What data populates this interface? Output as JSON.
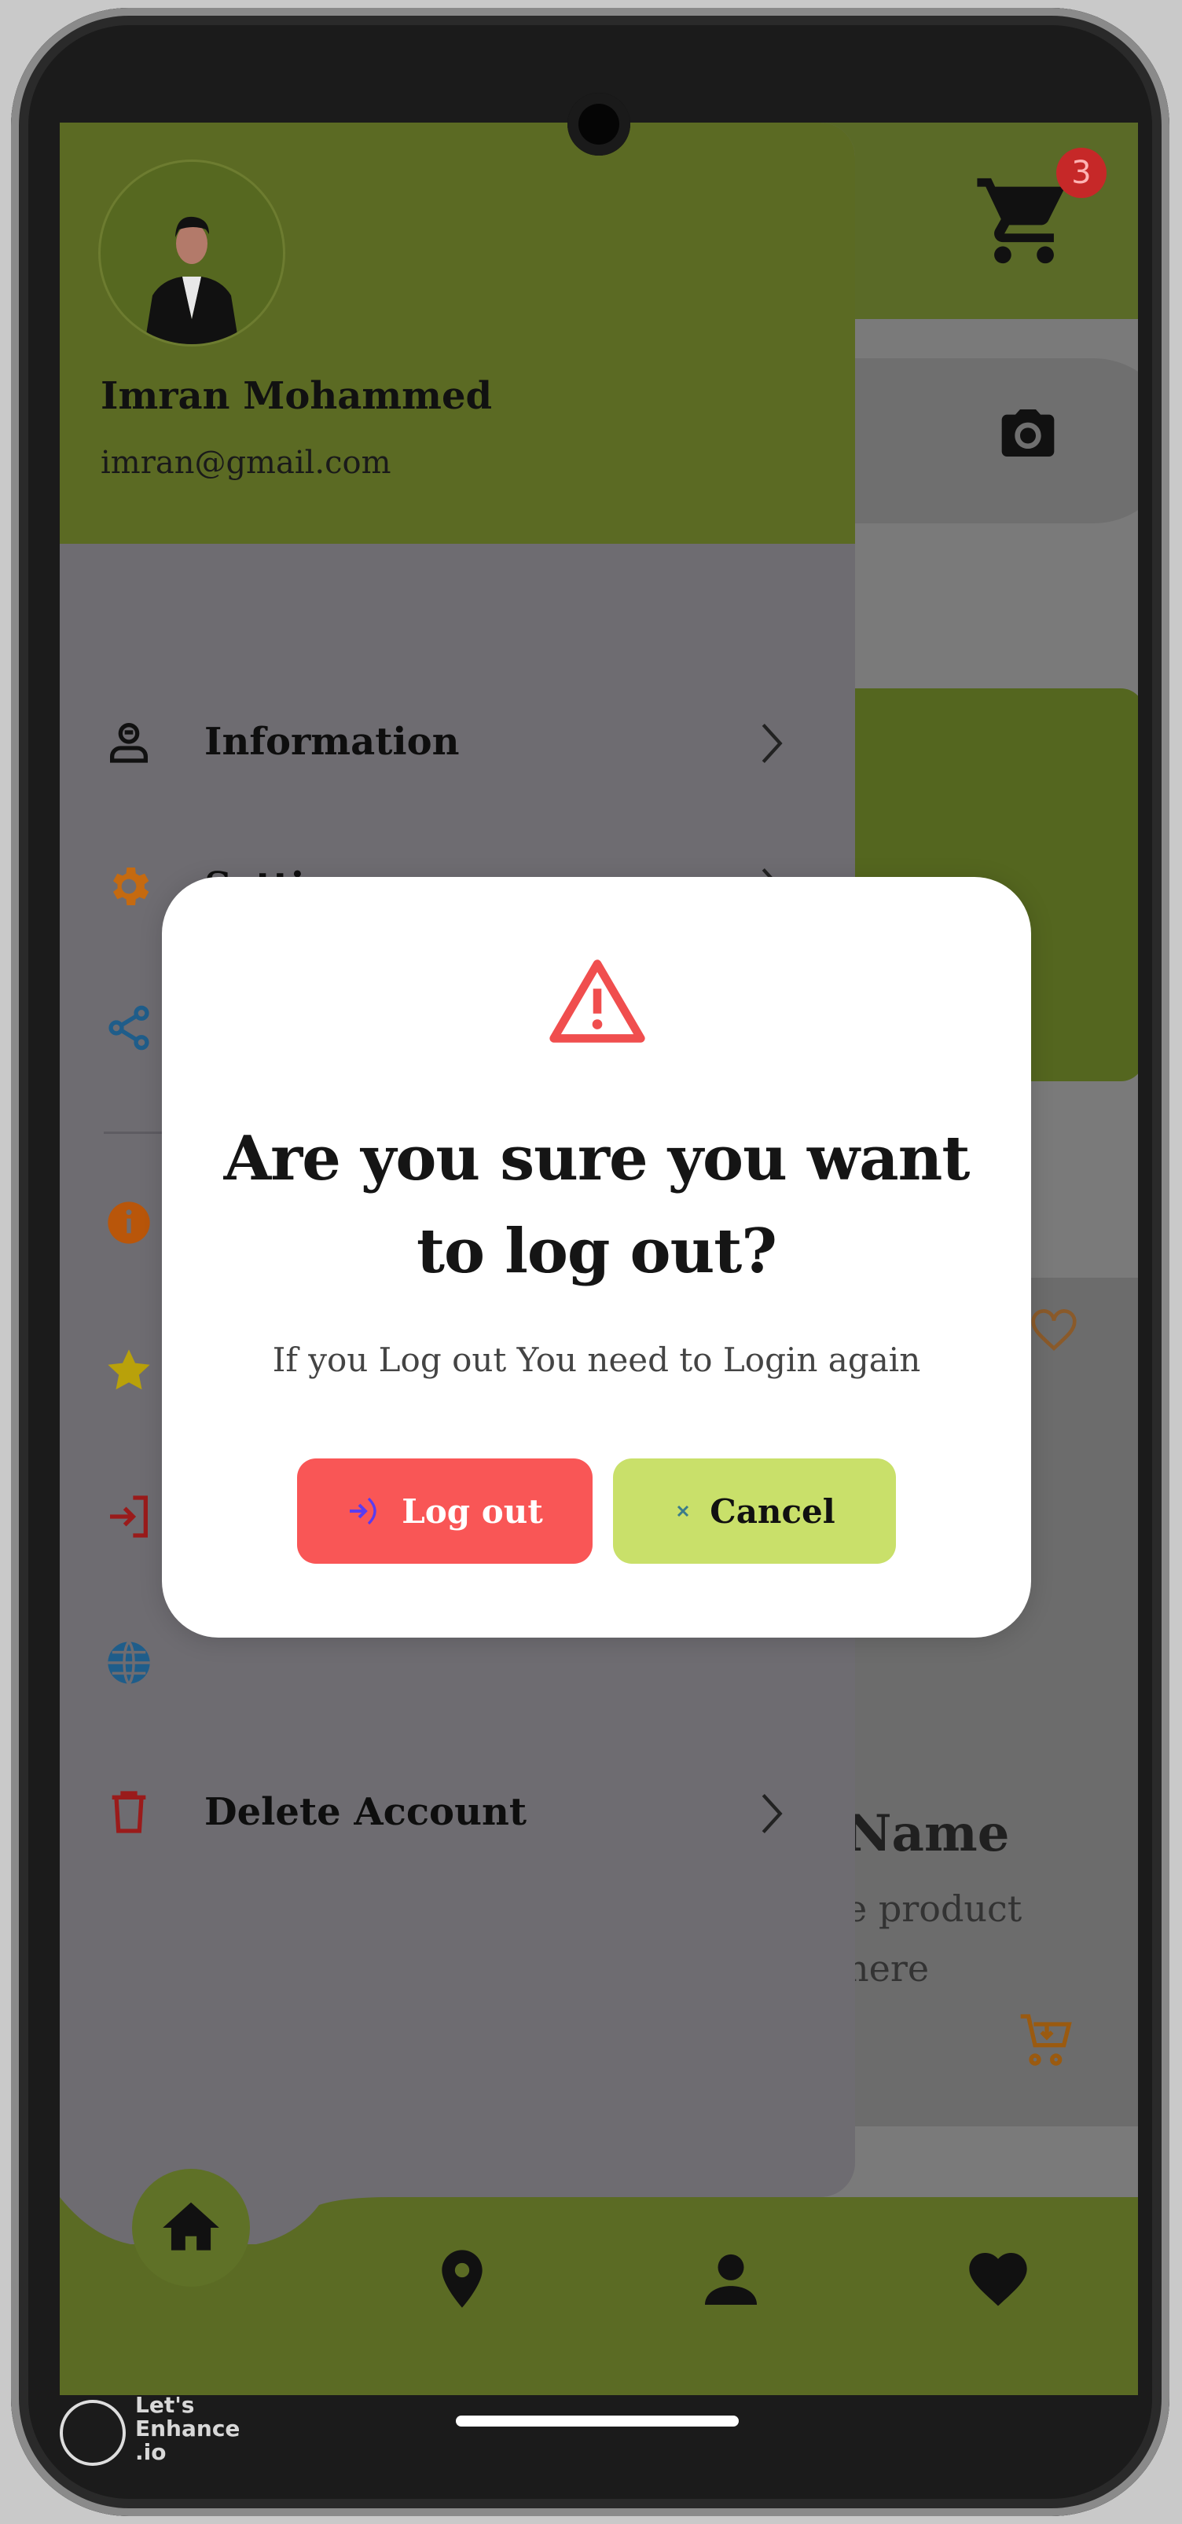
{
  "app": {
    "cart_count": "3",
    "colors": {
      "primary": "#5b6a23",
      "danger": "#f95656",
      "accent": "#c9e06a"
    }
  },
  "drawer": {
    "user_name": "Imran Mohammed",
    "user_email": "imran@gmail.com",
    "items": [
      {
        "label": "Information",
        "icon": "profile-icon"
      },
      {
        "label": "Settings",
        "icon": "gear-icon"
      },
      {
        "label": "",
        "icon": "share-icon"
      },
      {
        "label": "",
        "icon": "info-icon"
      },
      {
        "label": "",
        "icon": "star-icon"
      },
      {
        "label": "",
        "icon": "login-icon"
      },
      {
        "label": "",
        "icon": "globe-icon"
      },
      {
        "label": "Delete Account",
        "icon": "trash-icon"
      }
    ]
  },
  "background": {
    "product_name": "Name",
    "product_desc_line1": "e product",
    "product_desc_line2": "here"
  },
  "dialog": {
    "title": "Are you sure you want to log out?",
    "subtitle": "If you Log out You need to Login again",
    "logout_label": "Log out",
    "cancel_label": "Cancel"
  },
  "bottom_nav": [
    "home-icon",
    "location-icon",
    "user-icon",
    "heart-icon"
  ],
  "watermark": {
    "line1": "Let's",
    "line2": "Enhance",
    "line3": ".io"
  }
}
